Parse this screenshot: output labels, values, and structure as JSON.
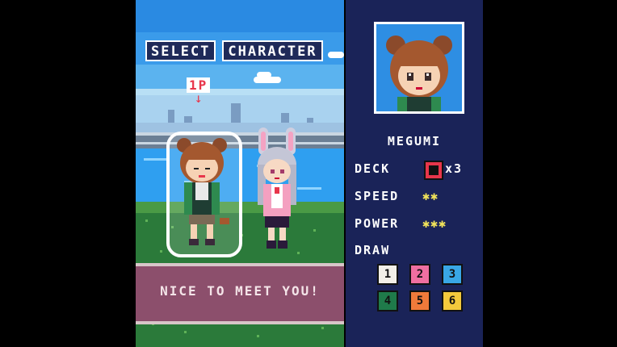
{
  "title": {
    "word1": "SELECT",
    "word2": "CHARACTER"
  },
  "indicator": {
    "label": "1P",
    "arrow": "↓"
  },
  "message": "NICE TO MEET YOU!",
  "character": {
    "name": "MEGUMI"
  },
  "stats": {
    "deck_label": "DECK",
    "deck_count": "x3",
    "speed_label": "SPEED",
    "speed_value": "✱✱",
    "speed_rating": 2,
    "power_label": "POWER",
    "power_value": "✱✱✱",
    "power_rating": 3,
    "draw_label": "DRAW"
  },
  "draw_cards": [
    {
      "label": "1",
      "color": "#f2efe8"
    },
    {
      "label": "2",
      "color": "#ef6fa0"
    },
    {
      "label": "3",
      "color": "#39a7e6"
    },
    {
      "label": "4",
      "color": "#1f7a4a"
    },
    {
      "label": "5",
      "color": "#f07a3a"
    },
    {
      "label": "6",
      "color": "#f3c93c"
    }
  ],
  "colors": {
    "panel_bg": "#1a2358",
    "accent_red": "#e8364b",
    "star_yellow": "#f0e25a",
    "message_box": "#8c4f6c"
  }
}
